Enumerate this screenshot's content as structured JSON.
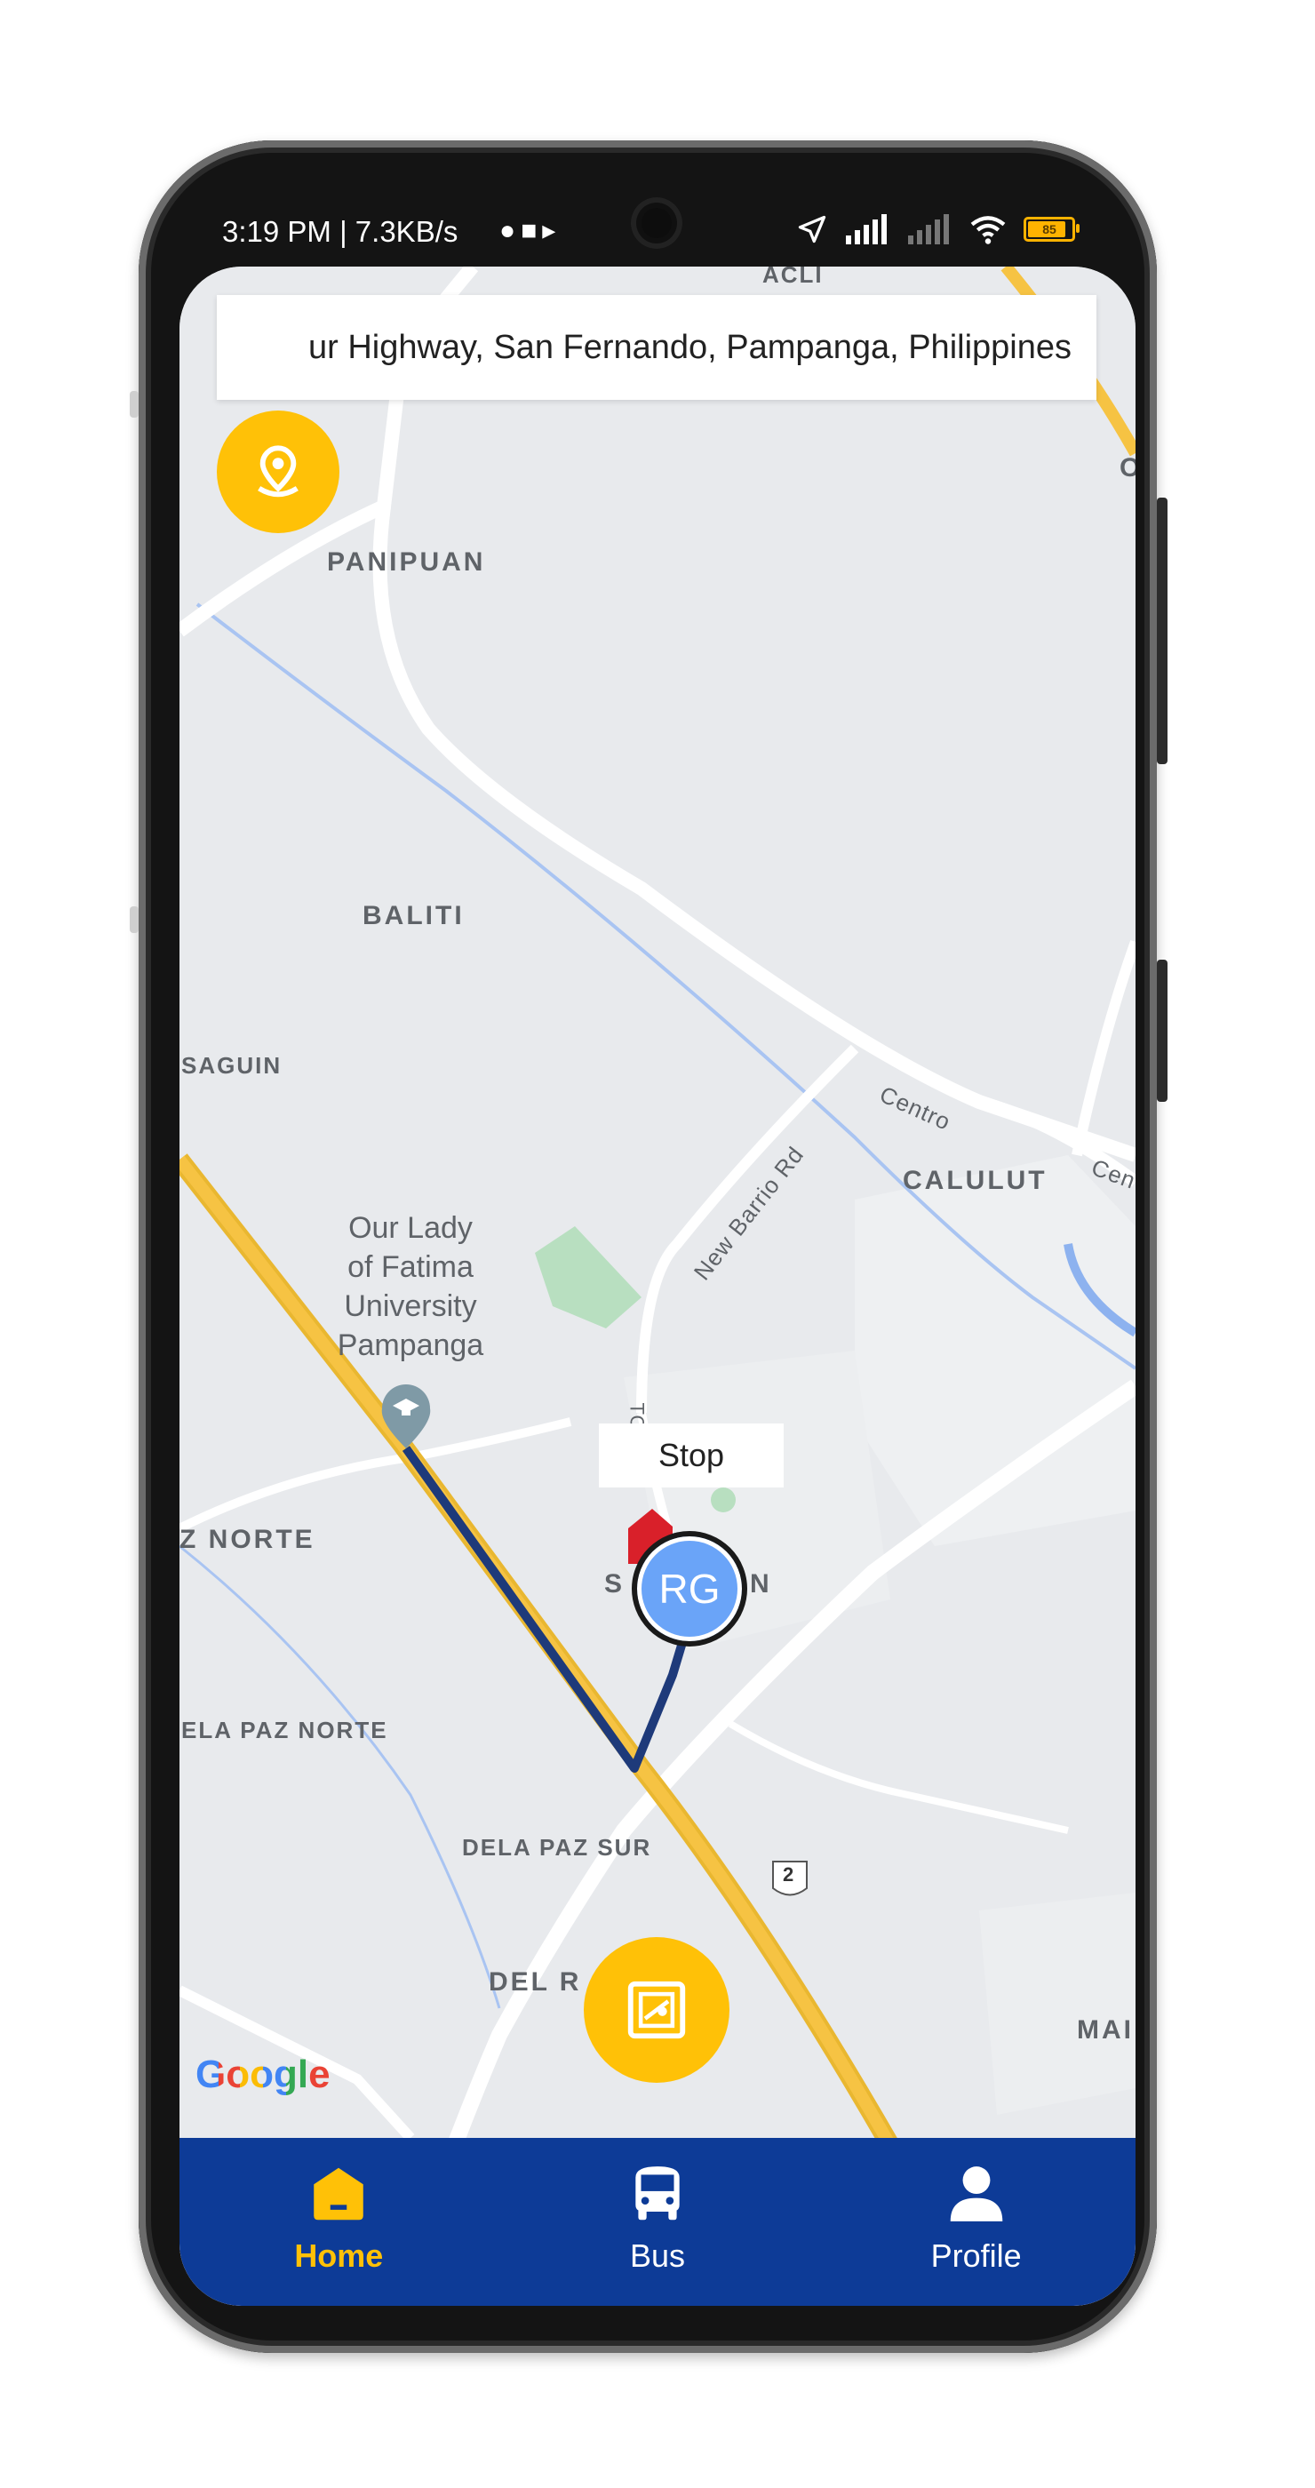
{
  "status_bar": {
    "time_and_speed": "3:19 PM | 7.3KB/s",
    "battery_level": "85"
  },
  "search": {
    "address": "ur Highway, San Fernando, Pampanga, Philippines"
  },
  "map": {
    "labels": {
      "acli": "ACLI",
      "panipuan": "PANIPUAN",
      "baliti": "BALITI",
      "saguin": "SAGUIN",
      "calulut": "CALULUT",
      "z_norte": "Z NORTE",
      "ela_paz_norte": "ELA PAZ NORTE",
      "dela_paz_sur": "DELA PAZ SUR",
      "del_r": "DEL R",
      "mai": "MAI",
      "centro": "Centro",
      "cen": "Cen",
      "new_barrio_rd": "New Barrio Rd",
      "road_2": "2",
      "o": "O",
      "s": "S",
      "n": "N",
      "side_road": "TOC"
    },
    "poi": {
      "name_line1": "Our Lady",
      "name_line2": "of Fatima",
      "name_line3": "University",
      "name_line4": "Pampanga"
    },
    "stop_label": "Stop",
    "user_initials": "RG",
    "attribution": "Google",
    "colors": {
      "route": "#1e3a7a",
      "highway": "#f6c343",
      "land": "#e8eaed",
      "park": "#b8dfc0"
    }
  },
  "nav": {
    "items": [
      {
        "label": "Home",
        "icon": "home-icon",
        "active": true
      },
      {
        "label": "Bus",
        "icon": "bus-icon",
        "active": false
      },
      {
        "label": "Profile",
        "icon": "profile-icon",
        "active": false
      }
    ]
  },
  "colors": {
    "accent": "#ffc107",
    "nav_bg": "#0d3b97",
    "avatar": "#6aa4f8"
  }
}
